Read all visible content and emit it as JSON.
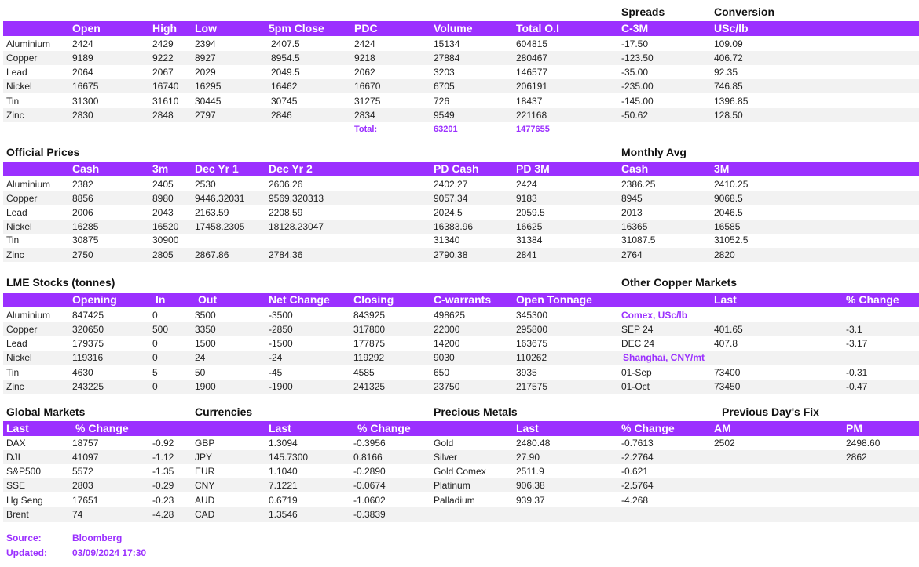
{
  "colors": {
    "accent": "#9b30ff",
    "stripe": "#f2f2f2"
  },
  "summary": {
    "top_labels": [
      "Spreads",
      "Conversion"
    ],
    "columns": [
      "Open",
      "High",
      "Low",
      "5pm Close",
      "PDC",
      "Volume",
      "Total O.I",
      "C-3M",
      "USc/lb"
    ],
    "rows": [
      [
        "Aluminium",
        "2424",
        "2429",
        "2394",
        "2407.5",
        "2424",
        "15134",
        "604815",
        "-17.50",
        "109.09"
      ],
      [
        "Copper",
        "9189",
        "9222",
        "8927",
        "8954.5",
        "9218",
        "27884",
        "280467",
        "-123.50",
        "406.72"
      ],
      [
        "Lead",
        "2064",
        "2067",
        "2029",
        "2049.5",
        "2062",
        "3203",
        "146577",
        "-35.00",
        "92.35"
      ],
      [
        "Nickel",
        "16675",
        "16740",
        "16295",
        "16462",
        "16670",
        "6705",
        "206191",
        "-235.00",
        "746.85"
      ],
      [
        "Tin",
        "31300",
        "31610",
        "30445",
        "30745",
        "31275",
        "726",
        "18437",
        "-145.00",
        "1396.85"
      ],
      [
        "Zinc",
        "2830",
        "2848",
        "2797",
        "2846",
        "2834",
        "9549",
        "221168",
        "-50.62",
        "128.50"
      ]
    ],
    "total": {
      "label": "Total:",
      "volume": "63201",
      "oi": "1477655"
    }
  },
  "official": {
    "title": "Official Prices",
    "monthly_title": "Monthly Avg",
    "columns": [
      "Cash",
      "3m",
      "Dec Yr 1",
      "Dec Yr 2",
      "PD Cash",
      "PD 3M",
      "Cash",
      "3M"
    ],
    "rows": [
      [
        "Aluminium",
        "2382",
        "2405",
        "2530",
        "2606.26",
        "2402.27",
        "2424",
        "2386.25",
        "2410.25"
      ],
      [
        "Copper",
        "8856",
        "8980",
        "9446.32031",
        "9569.320313",
        "9057.34",
        "9183",
        "8945",
        "9068.5"
      ],
      [
        "Lead",
        "2006",
        "2043",
        "2163.59",
        "2208.59",
        "2024.5",
        "2059.5",
        "2013",
        "2046.5"
      ],
      [
        "Nickel",
        "16285",
        "16520",
        "17458.2305",
        "18128.23047",
        "16383.96",
        "16625",
        "16365",
        "16585"
      ],
      [
        "Tin",
        "30875",
        "30900",
        "",
        "",
        "31340",
        "31384",
        "31087.5",
        "31052.5"
      ],
      [
        "Zinc",
        "2750",
        "2805",
        "2867.86",
        "2784.36",
        "2790.38",
        "2841",
        "2764",
        "2820"
      ]
    ]
  },
  "stocks": {
    "title": "LME Stocks (tonnes)",
    "other_title": "Other Copper Markets",
    "columns": [
      "Opening",
      "In",
      "Out",
      "Net Change",
      "Closing",
      "C-warrants",
      "Open Tonnage",
      "Last",
      "% Change"
    ],
    "rows": [
      [
        "Aluminium",
        "847425",
        "0",
        "3500",
        "-3500",
        "843925",
        "498625",
        "345300"
      ],
      [
        "Copper",
        "320650",
        "500",
        "3350",
        "-2850",
        "317800",
        "22000",
        "295800"
      ],
      [
        "Lead",
        "179375",
        "0",
        "1500",
        "-1500",
        "177875",
        "14200",
        "163675"
      ],
      [
        "Nickel",
        "119316",
        "0",
        "24",
        "-24",
        "119292",
        "9030",
        "110262"
      ],
      [
        "Tin",
        "4630",
        "5",
        "50",
        "-45",
        "4585",
        "650",
        "3935"
      ],
      [
        "Zinc",
        "243225",
        "0",
        "1900",
        "-1900",
        "241325",
        "23750",
        "217575"
      ]
    ],
    "other": [
      {
        "name": "Comex, USc/lb",
        "last": "",
        "chg": "",
        "heading": true
      },
      {
        "name": "SEP 24",
        "last": "401.65",
        "chg": "-3.1",
        "heading": false
      },
      {
        "name": "DEC 24",
        "last": "407.8",
        "chg": "-3.17",
        "heading": false
      },
      {
        "name": "Shanghai, CNY/mt",
        "last": "",
        "chg": "",
        "heading": true
      },
      {
        "name": "01-Sep",
        "last": "73400",
        "chg": "-0.31",
        "heading": false
      },
      {
        "name": "01-Oct",
        "last": "73450",
        "chg": "-0.47",
        "heading": false
      }
    ]
  },
  "markets": {
    "titles": [
      "Global Markets",
      "Currencies",
      "Precious Metals",
      "Previous Day's Fix"
    ],
    "columns": [
      "Last",
      "% Change",
      "Last",
      "% Change",
      "Last",
      "% Change",
      "AM",
      "PM"
    ],
    "global": [
      [
        "DAX",
        "18757",
        "-0.92"
      ],
      [
        "DJI",
        "41097",
        "-1.12"
      ],
      [
        "S&P500",
        "5572",
        "-1.35"
      ],
      [
        "SSE",
        "2803",
        "-0.29"
      ],
      [
        "Hg Seng",
        "17651",
        "-0.23"
      ],
      [
        "Brent",
        "74",
        "-4.28"
      ]
    ],
    "currencies": [
      [
        "GBP",
        "1.3094",
        "-0.3956"
      ],
      [
        "JPY",
        "145.7300",
        "0.8166"
      ],
      [
        "EUR",
        "1.1040",
        "-0.2890"
      ],
      [
        "CNY",
        "7.1221",
        "-0.0674"
      ],
      [
        "AUD",
        "0.6719",
        "-1.0602"
      ],
      [
        "CAD",
        "1.3546",
        "-0.3839"
      ]
    ],
    "precious": [
      [
        "Gold",
        "2480.48",
        "-0.7613",
        "2502",
        "2498.60"
      ],
      [
        "Silver",
        "27.90",
        "-2.2764",
        "",
        "2862"
      ],
      [
        "Gold Comex",
        "2511.9",
        "-0.621",
        "",
        ""
      ],
      [
        "Platinum",
        "906.38",
        "-2.5764",
        "",
        ""
      ],
      [
        "Palladium",
        "939.37",
        "-4.268",
        "",
        ""
      ]
    ]
  },
  "footer": {
    "source_label": "Source:",
    "source_value": "Bloomberg",
    "updated_label": "Updated:",
    "updated_value": "03/09/2024 17:30"
  }
}
